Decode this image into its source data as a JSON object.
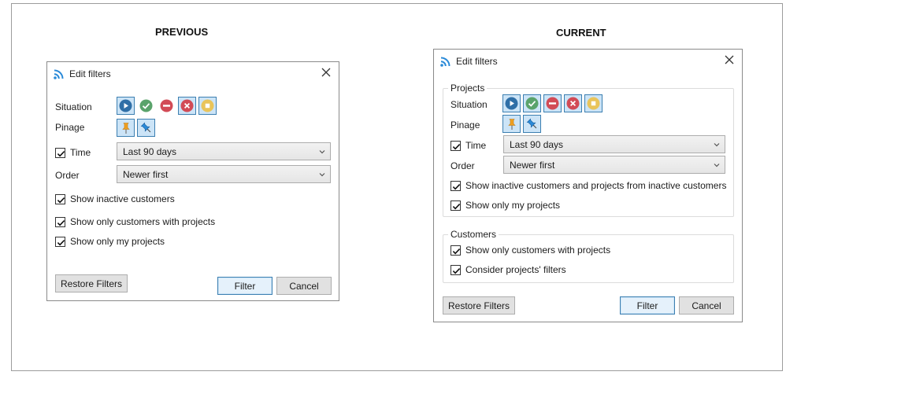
{
  "headings": {
    "previous": "PREVIOUS",
    "current": "CURRENT"
  },
  "previous_dialog": {
    "title": "Edit filters",
    "situation_label": "Situation",
    "pinage_label": "Pinage",
    "time_label": "Time",
    "time_value": "Last 90 days",
    "order_label": "Order",
    "order_value": "Newer first",
    "show_inactive_customers": "Show inactive customers",
    "show_only_customers_with_projects": "Show only customers with projects",
    "show_only_my_projects": "Show only my projects",
    "restore_filters": "Restore Filters",
    "filter": "Filter",
    "cancel": "Cancel"
  },
  "current_dialog": {
    "title": "Edit filters",
    "projects_group": "Projects",
    "situation_label": "Situation",
    "pinage_label": "Pinage",
    "time_label": "Time",
    "time_value": "Last 90 days",
    "order_label": "Order",
    "order_value": "Newer first",
    "show_inactive_customers_and_projects": "Show inactive customers and projects from inactive customers",
    "show_only_my_projects": "Show only my projects",
    "customers_group": "Customers",
    "show_only_customers_with_projects": "Show only customers with projects",
    "consider_projects_filters": "Consider projects' filters",
    "restore_filters": "Restore Filters",
    "filter": "Filter",
    "cancel": "Cancel"
  },
  "icons": {
    "situation": [
      "play-icon",
      "check-icon",
      "minus-icon",
      "x-icon",
      "stop-icon"
    ],
    "pinage": [
      "pin-icon",
      "unpin-icon"
    ]
  },
  "colors": {
    "accent_blue": "#3c7fb1",
    "play_blue": "#2f6fa7",
    "check_green": "#5aa36b",
    "minus_red": "#d24b56",
    "x_red": "#d24b56",
    "stop_yellow": "#e9c45a",
    "pin_orange": "#f0a020",
    "unpin_blue": "#2a8ad8"
  }
}
